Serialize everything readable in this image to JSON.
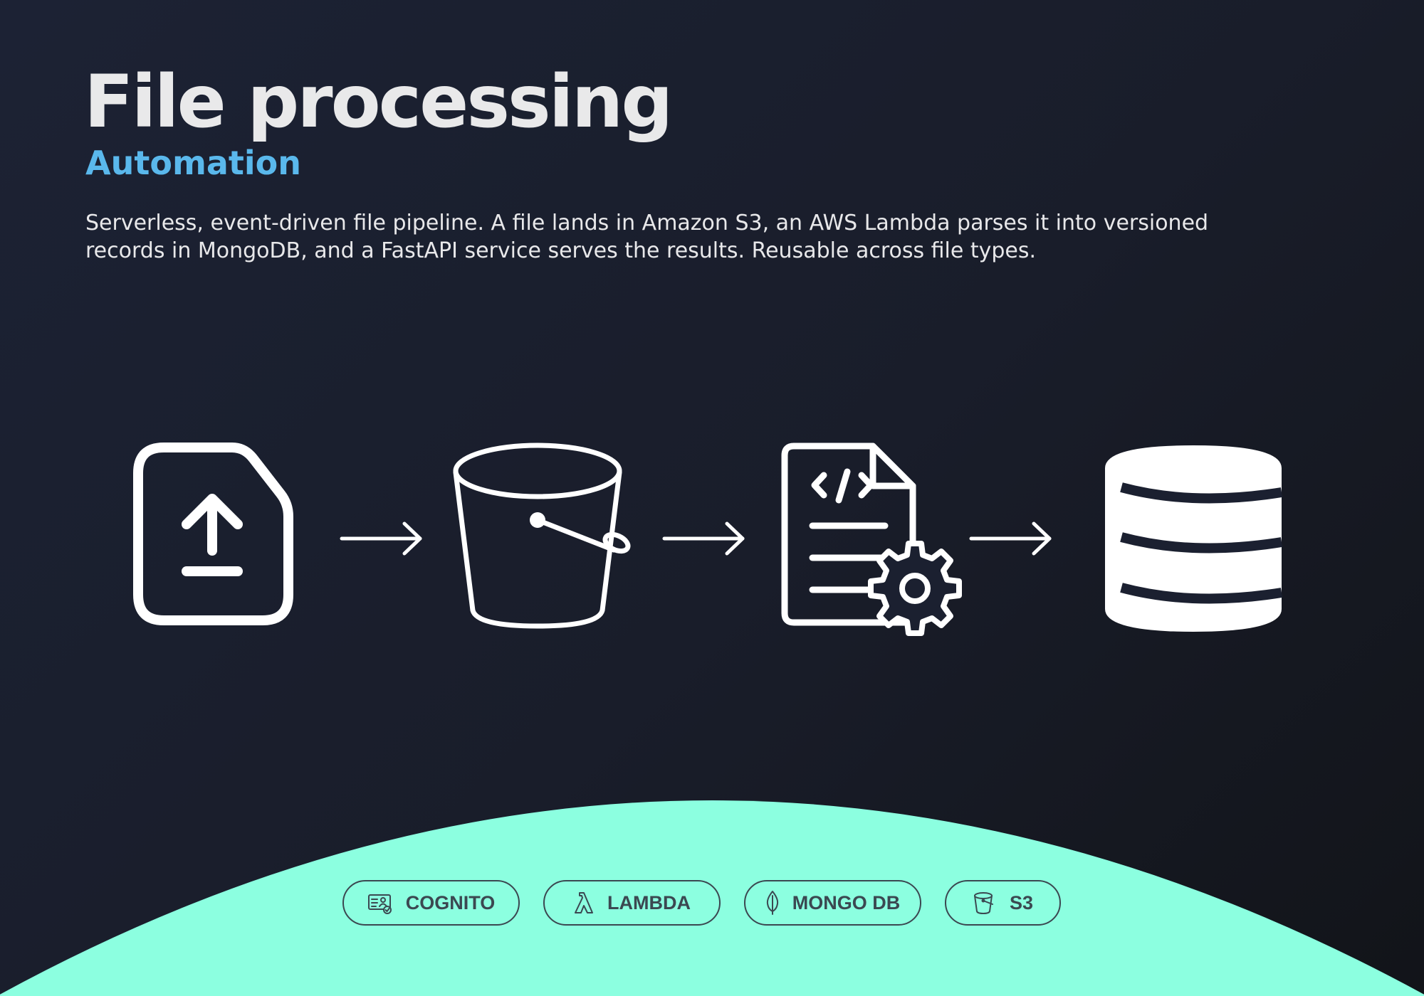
{
  "header": {
    "title": "File processing",
    "subtitle": "Automation",
    "description": "Serverless, event-driven file pipeline. A file lands in Amazon S3, an AWS Lambda parses it into versioned\nrecords in MongoDB, and a FastAPI service serves the results. Reusable across file types."
  },
  "flow": {
    "steps": [
      {
        "icon": "file-upload-icon"
      },
      {
        "icon": "s3-bucket-icon"
      },
      {
        "icon": "code-file-gear-icon"
      },
      {
        "icon": "database-icon"
      }
    ]
  },
  "tags": [
    {
      "label": "COGNITO",
      "icon": "cognito-icon"
    },
    {
      "label": "LAMBDA",
      "icon": "lambda-icon"
    },
    {
      "label": "MONGO DB",
      "icon": "mongodb-leaf-icon"
    },
    {
      "label": "S3",
      "icon": "bucket-icon"
    }
  ],
  "colors": {
    "accent": "#5ab8ec",
    "mint": "#8cffe0",
    "tag_text": "#3b4851",
    "title": "#e9e9ea"
  }
}
